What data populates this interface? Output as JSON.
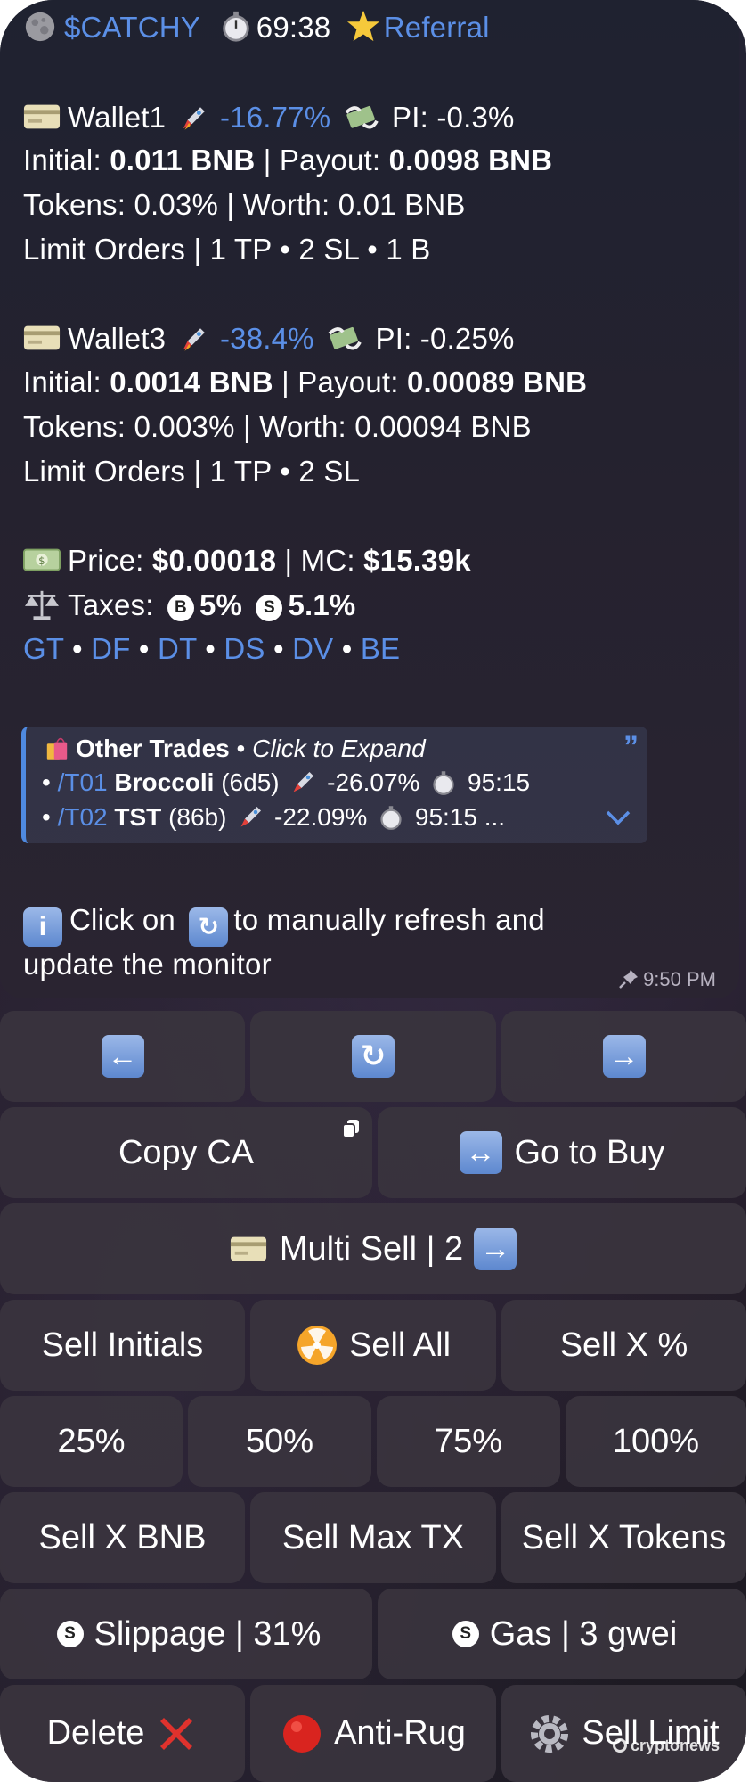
{
  "header": {
    "ticker": "$CATCHY",
    "timer": "69:38",
    "referral": "Referral"
  },
  "wallets": [
    {
      "name": "Wallet1",
      "change": "-16.77%",
      "pi": "PI: -0.3%",
      "initial_label": "Initial: ",
      "initial_value": "0.011 BNB",
      "payout_label": " | Payout: ",
      "payout_value": "0.0098 BNB",
      "tokens_line": "Tokens: 0.03% | Worth: 0.01 BNB",
      "orders_line": "Limit Orders | 1 TP • 2 SL • 1 B"
    },
    {
      "name": "Wallet3",
      "change": "-38.4%",
      "pi": "PI: -0.25%",
      "initial_label": "Initial: ",
      "initial_value": "0.0014 BNB",
      "payout_label": " | Payout: ",
      "payout_value": "0.00089 BNB",
      "tokens_line": "Tokens: 0.003% | Worth: 0.00094 BNB",
      "orders_line": "Limit Orders | 1 TP • 2 SL"
    }
  ],
  "price": {
    "label": "Price: ",
    "value": "$0.00018",
    "mc_label": " | MC: ",
    "mc_value": "$15.39k"
  },
  "taxes": {
    "label": "Taxes: ",
    "buy_badge": "B",
    "buy_value": "5%",
    "sell_badge": "S",
    "sell_value": "5.1%"
  },
  "links": [
    "GT",
    "DF",
    "DT",
    "DS",
    "DV",
    "BE"
  ],
  "other_trades": {
    "title": "Other Trades",
    "hint": "Click to Expand",
    "items": [
      {
        "id": "/T01",
        "name": "Broccoli",
        "code": "(6d5)",
        "change": "-26.07%",
        "time": "95:15"
      },
      {
        "id": "/T02",
        "name": "TST",
        "code": "(86b)",
        "change": "-22.09%",
        "time": "95:15 ..."
      }
    ]
  },
  "info": {
    "line1_a": "Click on",
    "line1_b": "to manually refresh and",
    "line2": "update the monitor"
  },
  "message_time": "9:50 PM",
  "keyboard": {
    "copy_ca": "Copy CA",
    "go_to_buy": "Go to Buy",
    "multi_sell": "Multi Sell | 2",
    "sell_initials": "Sell Initials",
    "sell_all": "Sell All",
    "sell_x_pct": "Sell X %",
    "pct_25": "25%",
    "pct_50": "50%",
    "pct_75": "75%",
    "pct_100": "100%",
    "sell_x_bnb": "Sell X BNB",
    "sell_max_tx": "Sell Max TX",
    "sell_x_tokens": "Sell X Tokens",
    "slippage": "Slippage | 31%",
    "gas": "Gas | 3 gwei",
    "delete": "Delete",
    "anti_rug": "Anti-Rug",
    "sell_limit": "Sell Limit",
    "slippage_badge": "S",
    "gas_badge": "S"
  },
  "watermark": "cryptonews",
  "colors": {
    "link_blue": "#5b8fe6",
    "button_bg": "#3a343e",
    "quote_bar": "#4f8ae0"
  }
}
